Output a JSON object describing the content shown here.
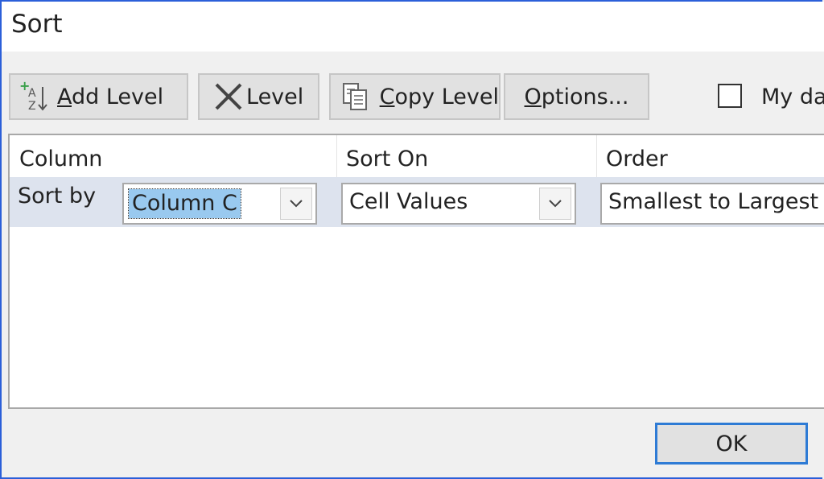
{
  "dialog": {
    "title": "Sort"
  },
  "toolbar": {
    "add_level": {
      "mnemonic": "A",
      "rest": "dd Level",
      "icon": "add-sort-level-icon"
    },
    "delete_level": {
      "label": "Level",
      "icon": "delete-x-icon"
    },
    "copy_level": {
      "mnemonic": "C",
      "rest": "opy Level",
      "icon": "copy-icon"
    },
    "options": {
      "mnemonic": "O",
      "rest": "ptions..."
    },
    "headers_checkbox": {
      "label": "My da",
      "checked": false
    }
  },
  "grid": {
    "headers": {
      "column": "Column",
      "sort_on": "Sort On",
      "order": "Order"
    },
    "row": {
      "label": "Sort by",
      "column_value": "Column C",
      "sort_on_value": "Cell Values",
      "order_value": "Smallest to Largest"
    }
  },
  "footer": {
    "ok_label": "OK"
  },
  "colors": {
    "accent": "#2e7bd5",
    "selection": "#99c9ef",
    "row_highlight": "#dde3ee"
  }
}
